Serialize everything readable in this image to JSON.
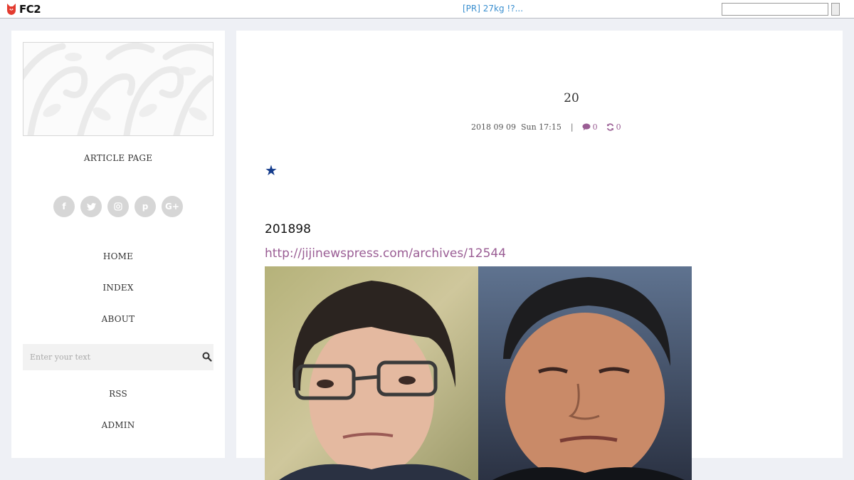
{
  "topbar": {
    "brand": "FC2",
    "pr_link": "[PR] 27kg !?...",
    "search_value": ""
  },
  "sidebar": {
    "page_type": "ARTICLE PAGE",
    "social": [
      {
        "name": "facebook",
        "glyph": "f"
      },
      {
        "name": "twitter",
        "glyph": "t"
      },
      {
        "name": "instagram",
        "glyph": "◎"
      },
      {
        "name": "pinterest",
        "glyph": "p"
      },
      {
        "name": "google-plus",
        "glyph": "G+"
      }
    ],
    "nav": {
      "home": "HOME",
      "index": "INDEX",
      "about": "ABOUT",
      "rss": "RSS",
      "admin": "ADMIN"
    },
    "search_placeholder": "Enter your text"
  },
  "post": {
    "title": "20",
    "date": "2018 09 09",
    "day_time": "Sun 17:15",
    "separator": "|",
    "comments": "0",
    "trackbacks": "0",
    "star": "★",
    "date_line": "201898",
    "link": "http://jijinewspress.com/archives/12544"
  },
  "colors": {
    "accent": "#9a5d94",
    "link_blue": "#3a8fcf",
    "background": "#eef0f5",
    "star": "#143c8c"
  }
}
